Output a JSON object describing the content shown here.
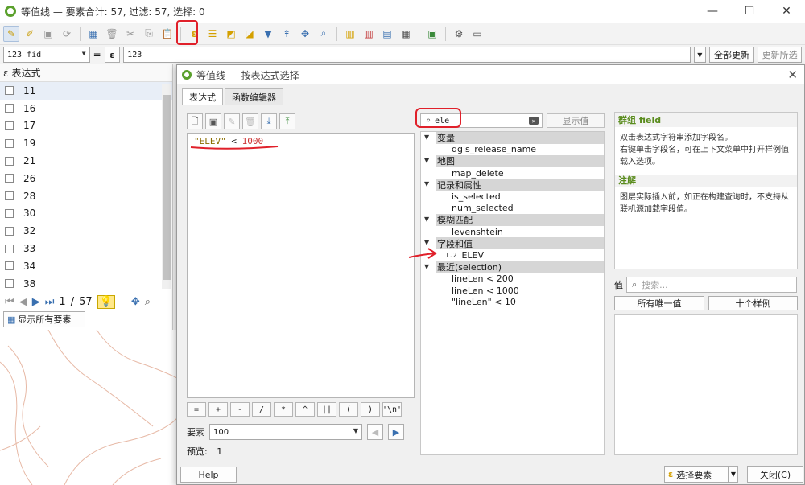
{
  "main_window": {
    "title": "等值线 — 要素合计: 57, 过滤: 57, 选择: 0",
    "controls": [
      "—",
      "☐",
      "✕"
    ]
  },
  "expr_bar": {
    "field_combo": "123 fid",
    "equals": "=",
    "epsilon": "ε",
    "value": "123",
    "update_all": "全部更新",
    "update_selected": "更新所选"
  },
  "left_panel": {
    "header": "表达式",
    "rows": [
      "11",
      "16",
      "17",
      "19",
      "21",
      "26",
      "28",
      "30",
      "32",
      "33",
      "34",
      "38"
    ],
    "page_current": "1",
    "page_sep": "/",
    "page_total": "57",
    "show_all": "显示所有要素"
  },
  "dialog": {
    "title": "等值线 — 按表达式选择",
    "tabs": [
      "表达式",
      "函数编辑器"
    ],
    "expression": {
      "field": "\"ELEV\"",
      "operator": " < ",
      "number": "1000"
    },
    "operators": [
      "=",
      "+",
      "-",
      "/",
      "*",
      "^",
      "||",
      "(",
      ")",
      "'\\n'"
    ],
    "feature_label": "要素",
    "feature_value": "100",
    "preview_label": "预览:",
    "preview_value": "1",
    "search": {
      "value": "ele",
      "show_values": "显示值"
    },
    "tree": [
      {
        "group": "变量",
        "items": [
          "qgis_release_name"
        ]
      },
      {
        "group": "地图",
        "items": [
          "map_delete"
        ]
      },
      {
        "group": "记录和属性",
        "items": [
          "is_selected",
          "num_selected"
        ]
      },
      {
        "group": "模糊匹配",
        "items": [
          "levenshtein"
        ]
      },
      {
        "group": "字段和值",
        "items": [
          "ELEV"
        ]
      },
      {
        "group": "最近(selection)",
        "items": [
          "lineLen < 200",
          "lineLen < 1000",
          "\"lineLen\" < 10"
        ]
      }
    ],
    "field_type_tag": "1.2",
    "help": {
      "title": "群组 field",
      "body1": "双击表达式字符串添加字段名。",
      "body2": "右键单击字段名，可在上下文菜单中打开样例值载入选项。",
      "notes_title": "注解",
      "notes": "图层实际插入前，如正在构建查询时，不支持从联机源加载字段值。"
    },
    "values": {
      "label": "值",
      "search_placeholder": "搜索...",
      "all_unique": "所有唯一值",
      "ten_samples": "十个样例"
    },
    "buttons": {
      "help": "Help",
      "select_features": "选择要素",
      "close": "关闭(C)"
    }
  },
  "colors": {
    "annotation_red": "#e0202a",
    "help_title_green": "#5a8c1e",
    "field_gold": "#8a6e00",
    "number_red": "#cc3333"
  }
}
